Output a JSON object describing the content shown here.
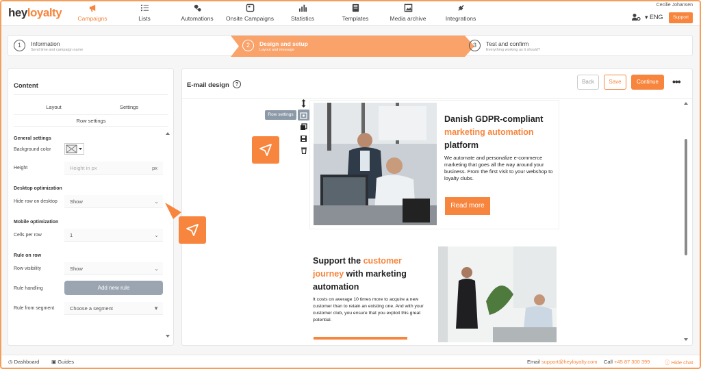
{
  "brand": {
    "part1": "hey",
    "part2": "loyalty"
  },
  "nav": [
    {
      "label": "Campaigns",
      "icon": "megaphone-icon",
      "active": true
    },
    {
      "label": "Lists",
      "icon": "list-icon"
    },
    {
      "label": "Automations",
      "icon": "automation-icon"
    },
    {
      "label": "Onsite Campaigns",
      "icon": "onsite-icon"
    },
    {
      "label": "Statistics",
      "icon": "bar-chart-icon"
    },
    {
      "label": "Templates",
      "icon": "template-icon"
    },
    {
      "label": "Media archive",
      "icon": "image-icon"
    },
    {
      "label": "Integrations",
      "icon": "plug-icon"
    }
  ],
  "user": {
    "name": "Cecilie Johansen",
    "language": "ENG",
    "support_label": "Support"
  },
  "steps": [
    {
      "num": "1",
      "title": "Information",
      "subtitle": "Send time and campaign name"
    },
    {
      "num": "2",
      "title": "Design and setup",
      "subtitle": "Layout and message",
      "active": true
    },
    {
      "num": "3",
      "title": "Test and confirm",
      "subtitle": "Everything working as it should?"
    }
  ],
  "content_panel": {
    "title": "Content",
    "tabs": {
      "layout": "Layout",
      "settings": "Settings",
      "row_settings": "Row settings"
    },
    "general": {
      "heading": "General settings",
      "bg_label": "Background color",
      "height_label": "Height",
      "height_placeholder": "Height in px",
      "height_unit": "px"
    },
    "desktop": {
      "heading": "Desktop optimization",
      "hide_label": "Hide row on desktop",
      "hide_value": "Show"
    },
    "mobile": {
      "heading": "Mobile optimization",
      "cells_label": "Cells per row",
      "cells_value": "1"
    },
    "rule": {
      "heading": "Rule on row",
      "visibility_label": "Row visibility",
      "visibility_value": "Show",
      "handling_label": "Rule handling",
      "add_rule": "Add new rule",
      "segment_label": "Rule from segment",
      "segment_value": "Choose a segment"
    }
  },
  "design_panel": {
    "title": "E-mail design",
    "buttons": {
      "back": "Back",
      "save": "Save",
      "continue": "Continue"
    },
    "tooltip": "Row settings",
    "block1": {
      "h_part1": "Danish GDPR-compliant ",
      "h_highlight": "marketing automation",
      "h_part2": " platform",
      "text": "We automate and personalize e-commerce marketing that goes all the way around your business. From the first visit to your webshop to loyalty clubs.",
      "button": "Read more"
    },
    "block2": {
      "h_part1": "Support the ",
      "h_highlight": "customer journey",
      "h_part2": " with marketing automation",
      "text": "It costs on average 10 times more to acquire a new customer than to retain an existing one. And with your customer club, you ensure that you exploit this great potential."
    }
  },
  "footer": {
    "dashboard": "Dashboard",
    "guides": "Guides",
    "email_label": "Email",
    "email": "support@heyloyalty.com",
    "call_label": "Call",
    "phone": "+45 87 300 399",
    "hide_chat": "Hide chat"
  },
  "colors": {
    "accent": "#f7853d",
    "muted_button": "#9aa5b1"
  }
}
